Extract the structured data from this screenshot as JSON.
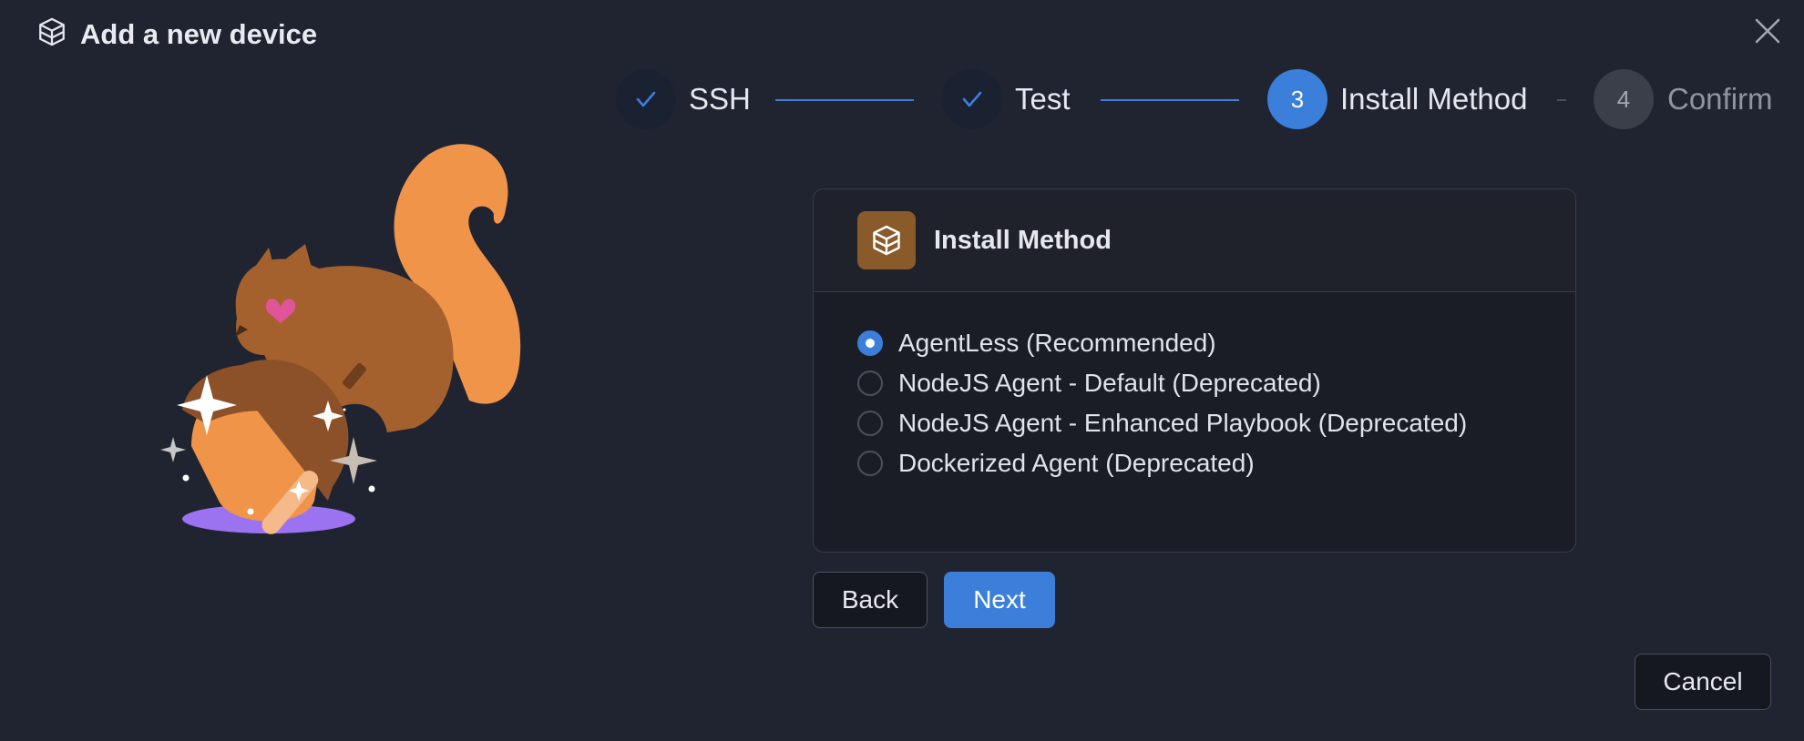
{
  "dialog": {
    "title": "Add a new device"
  },
  "steps": [
    {
      "number": "1",
      "label": "SSH",
      "state": "done"
    },
    {
      "number": "2",
      "label": "Test",
      "state": "done"
    },
    {
      "number": "3",
      "label": "Install Method",
      "state": "active"
    },
    {
      "number": "4",
      "label": "Confirm",
      "state": "todo"
    }
  ],
  "panel": {
    "title": "Install Method",
    "options": [
      {
        "label": "AgentLess (Recommended)",
        "selected": true
      },
      {
        "label": "NodeJS Agent - Default (Deprecated)",
        "selected": false
      },
      {
        "label": "NodeJS Agent - Enhanced Playbook (Deprecated)",
        "selected": false
      },
      {
        "label": "Dockerized Agent (Deprecated)",
        "selected": false
      }
    ]
  },
  "buttons": {
    "back": "Back",
    "next": "Next",
    "cancel": "Cancel"
  },
  "icons": {
    "header": "box-icon",
    "close": "close-icon",
    "method": "box-icon",
    "step_done": "check-icon"
  },
  "colors": {
    "accent": "#3b7fdb",
    "background": "#202431",
    "panel": "#1a1d25",
    "method_icon_bg": "#8a5a2a"
  }
}
